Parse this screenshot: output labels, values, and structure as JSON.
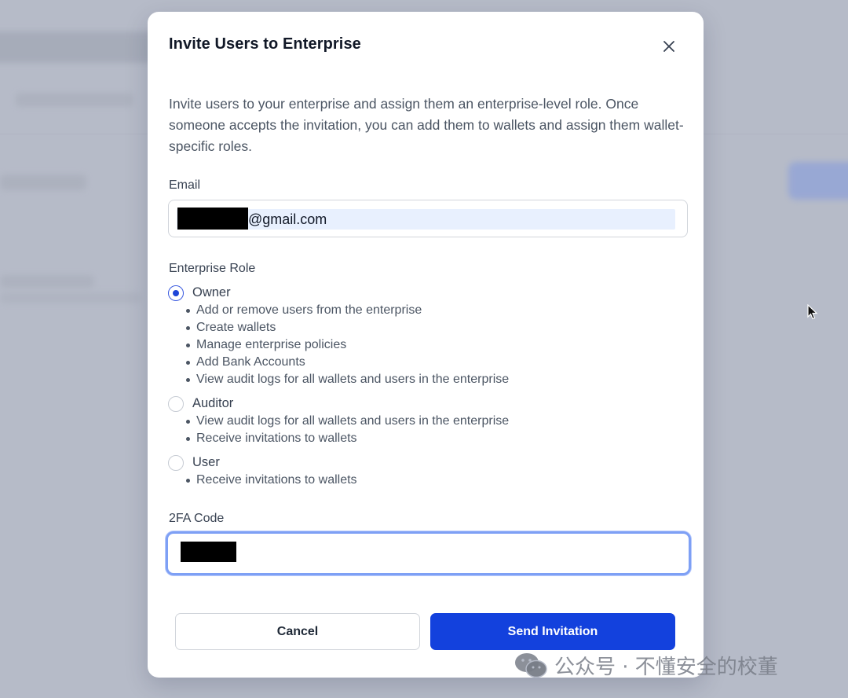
{
  "modal": {
    "title": "Invite Users to Enterprise",
    "description": "Invite users to your enterprise and assign them an enterprise-level role. Once someone accepts the invitation, you can add them to wallets and assign them wallet-specific roles."
  },
  "email": {
    "label": "Email",
    "value_suffix": "@gmail.com"
  },
  "role": {
    "label": "Enterprise Role",
    "selected": "Owner",
    "options": [
      {
        "name": "Owner",
        "permissions": [
          "Add or remove users from the enterprise",
          "Create wallets",
          "Manage enterprise policies",
          "Add Bank Accounts",
          "View audit logs for all wallets and users in the enterprise"
        ]
      },
      {
        "name": "Auditor",
        "permissions": [
          "View audit logs for all wallets and users in the enterprise",
          "Receive invitations to wallets"
        ]
      },
      {
        "name": "User",
        "permissions": [
          "Receive invitations to wallets"
        ]
      }
    ]
  },
  "twofa": {
    "label": "2FA Code"
  },
  "buttons": {
    "cancel": "Cancel",
    "send": "Send Invitation"
  },
  "watermark": {
    "text": "公众号 · 不懂安全的校董"
  },
  "colors": {
    "primary": "#1341dd",
    "focus_ring": "#7ea0f5",
    "overlay": "#b6bbc8"
  }
}
